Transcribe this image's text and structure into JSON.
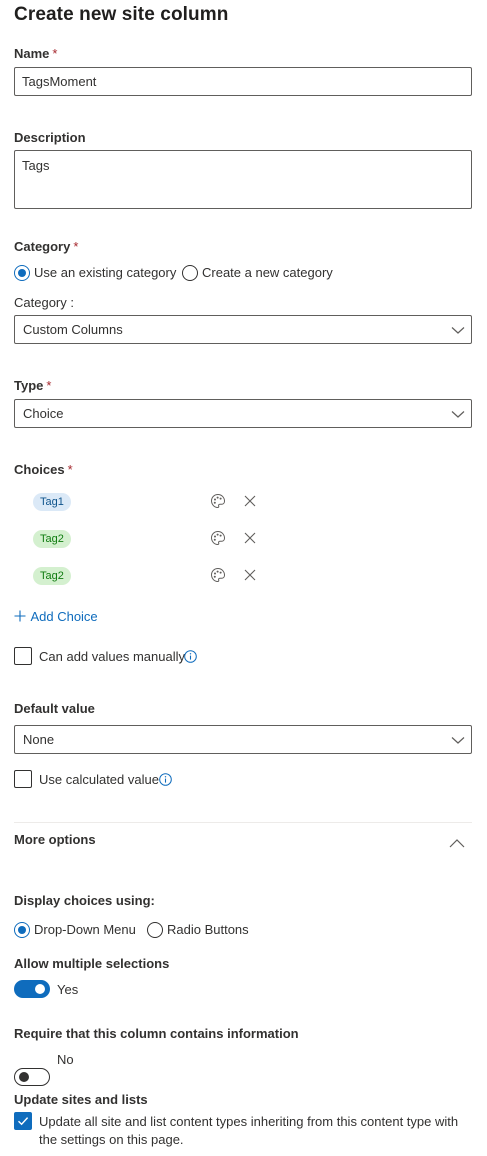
{
  "page": {
    "title": "Create new site column"
  },
  "name": {
    "label": "Name",
    "required_mark": "*",
    "value": "TagsMoment"
  },
  "description": {
    "label": "Description",
    "value": "Tags"
  },
  "category": {
    "label": "Category",
    "required_mark": "*",
    "option_existing": "Use an existing category",
    "option_new": "Create a new category",
    "selected": "existing",
    "sub_label": "Category :",
    "dropdown_value": "Custom Columns"
  },
  "type": {
    "label": "Type",
    "required_mark": "*",
    "dropdown_value": "Choice"
  },
  "choices": {
    "label": "Choices",
    "required_mark": "*",
    "items": [
      {
        "label": "Tag1",
        "bg": "#dbe9f7",
        "fg": "#0f548c"
      },
      {
        "label": "Tag2",
        "bg": "#d4f0cf",
        "fg": "#107c10"
      },
      {
        "label": "Tag2",
        "bg": "#d4f0cf",
        "fg": "#107c10"
      }
    ],
    "add_label": "Add Choice",
    "manual_label": "Can add values manually",
    "manual_checked": false
  },
  "default_value": {
    "label": "Default value",
    "dropdown_value": "None",
    "calculated_label": "Use calculated value",
    "calculated_checked": false
  },
  "more_options": {
    "label": "More options",
    "expanded": true
  },
  "display": {
    "label": "Display choices using:",
    "option_dropdown": "Drop-Down Menu",
    "option_radio": "Radio Buttons",
    "selected": "dropdown"
  },
  "multiple": {
    "label": "Allow multiple selections",
    "state_label": "Yes",
    "on": true
  },
  "require": {
    "label": "Require that this column contains information",
    "state_label": "No",
    "on": false
  },
  "update": {
    "label": "Update sites and lists",
    "checkbox_label": "Update all site and list content types inheriting from this content type with the settings on this page.",
    "checked": true
  },
  "colors": {
    "accent": "#0f6cbd",
    "required": "#a4262c",
    "text": "#323130"
  }
}
